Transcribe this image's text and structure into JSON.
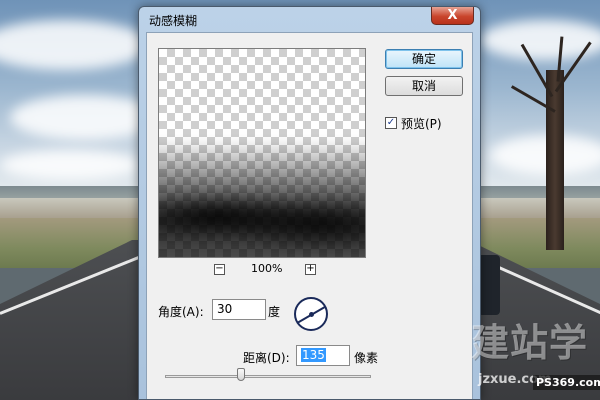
{
  "dialog": {
    "title": "动感模糊",
    "close_label": "X"
  },
  "buttons": {
    "ok": "确定",
    "cancel": "取消"
  },
  "preview_checkbox": {
    "label": "预览(P)",
    "checked": true,
    "check_glyph": "✓"
  },
  "zoom": {
    "minus": "−",
    "plus": "+",
    "level": "100%"
  },
  "angle": {
    "label": "角度(A):",
    "value": "30",
    "unit": "度"
  },
  "distance": {
    "label": "距离(D):",
    "value": "135",
    "unit": "像素"
  },
  "watermark": {
    "logo_text": "建站学",
    "url": "jzxue.com",
    "badge": "PS369.com"
  },
  "colors": {
    "selection": "#3399ff",
    "close_button": "#c9452c"
  }
}
